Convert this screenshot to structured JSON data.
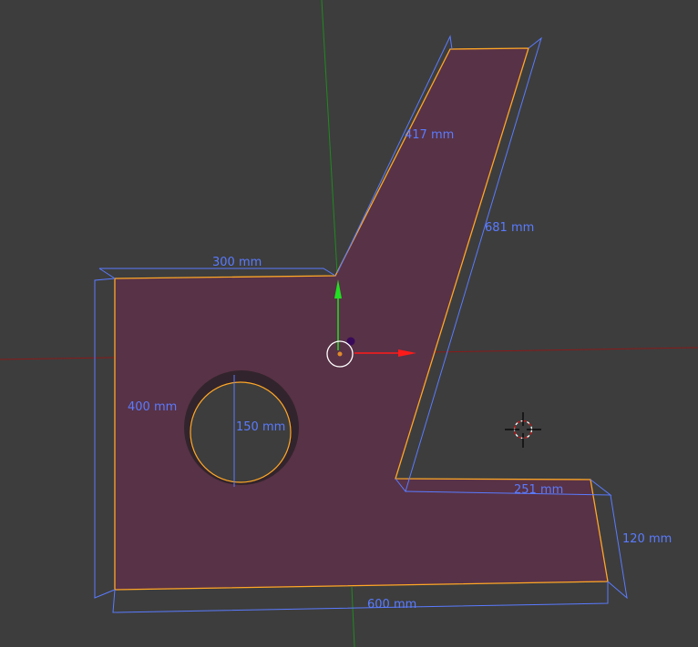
{
  "viewport": {
    "dimensions": [
      {
        "id": "top-arm-edge",
        "label": "417 mm"
      },
      {
        "id": "right-slant-edge",
        "label": "681 mm"
      },
      {
        "id": "top-left-edge",
        "label": "300 mm"
      },
      {
        "id": "left-edge",
        "label": "400 mm"
      },
      {
        "id": "hole-diameter",
        "label": "150 mm"
      },
      {
        "id": "foot-top-edge",
        "label": "251 mm"
      },
      {
        "id": "foot-right-edge",
        "label": "120 mm"
      },
      {
        "id": "bottom-edge",
        "label": "600 mm"
      }
    ]
  },
  "colors": {
    "background": "#3d3d3d",
    "face": "#583246",
    "edge_selected": "#ffa726",
    "dimension": "#5a7bff",
    "x_axis": "#b01c1c",
    "y_axis": "#1fa81f"
  }
}
